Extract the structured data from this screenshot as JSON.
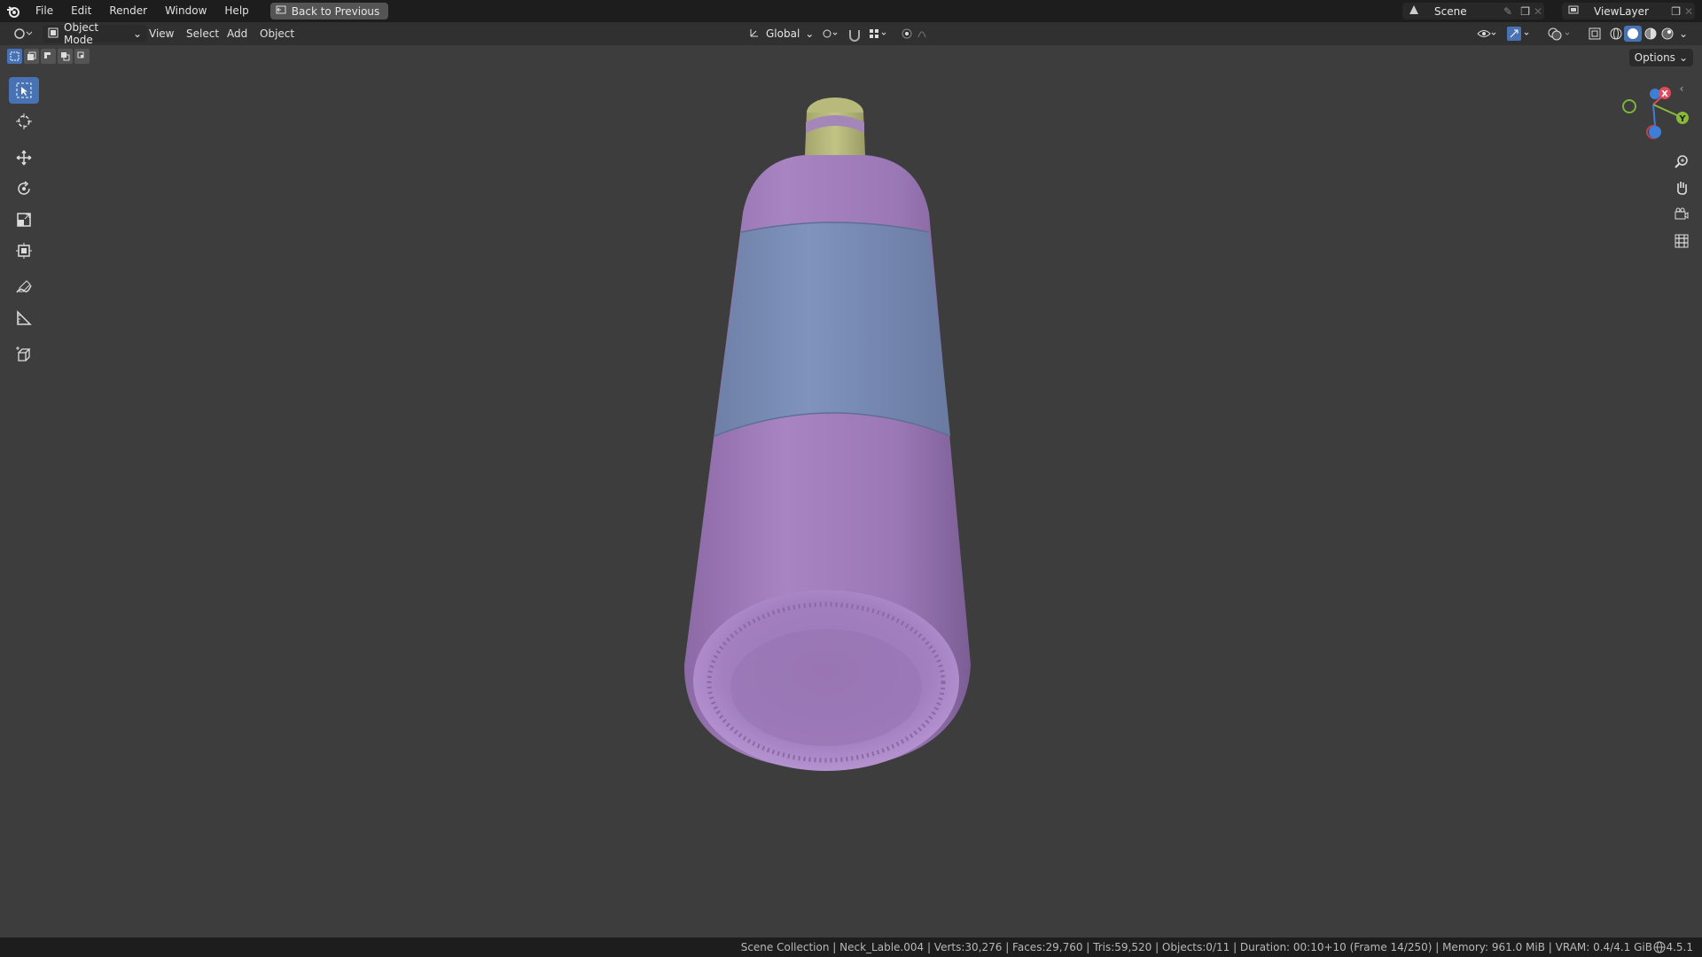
{
  "topbar": {
    "menus": [
      "File",
      "Edit",
      "Render",
      "Window",
      "Help"
    ],
    "back_button": "Back to Previous",
    "scene_name": "Scene",
    "view_layer": "ViewLayer"
  },
  "header": {
    "mode": "Object Mode",
    "menus": [
      "View",
      "Select",
      "Add",
      "Object"
    ],
    "orientation": "Global",
    "options": "Options"
  },
  "toolbar": {
    "tools": [
      "select-box",
      "cursor",
      "move",
      "rotate",
      "scale",
      "transform",
      "annotate",
      "measure",
      "add-cube"
    ],
    "active": "select-box"
  },
  "status": {
    "info": "Scene Collection | Neck_Lable.004 | Verts:30,276 | Faces:29,760 | Tris:59,520 | Objects:0/11 | Duration: 00:10+10 (Frame 14/250) | Memory: 961.0 MiB | VRAM: 0.4/4.1 GiB",
    "version": "4.5.1"
  },
  "gizmo": {
    "x": "X",
    "y": "Y",
    "z": "Z"
  },
  "colors": {
    "bottle_body": "#a27fbf",
    "label": "#7a8fb8",
    "cap": "#b5b777",
    "accent": "#4772b3"
  }
}
